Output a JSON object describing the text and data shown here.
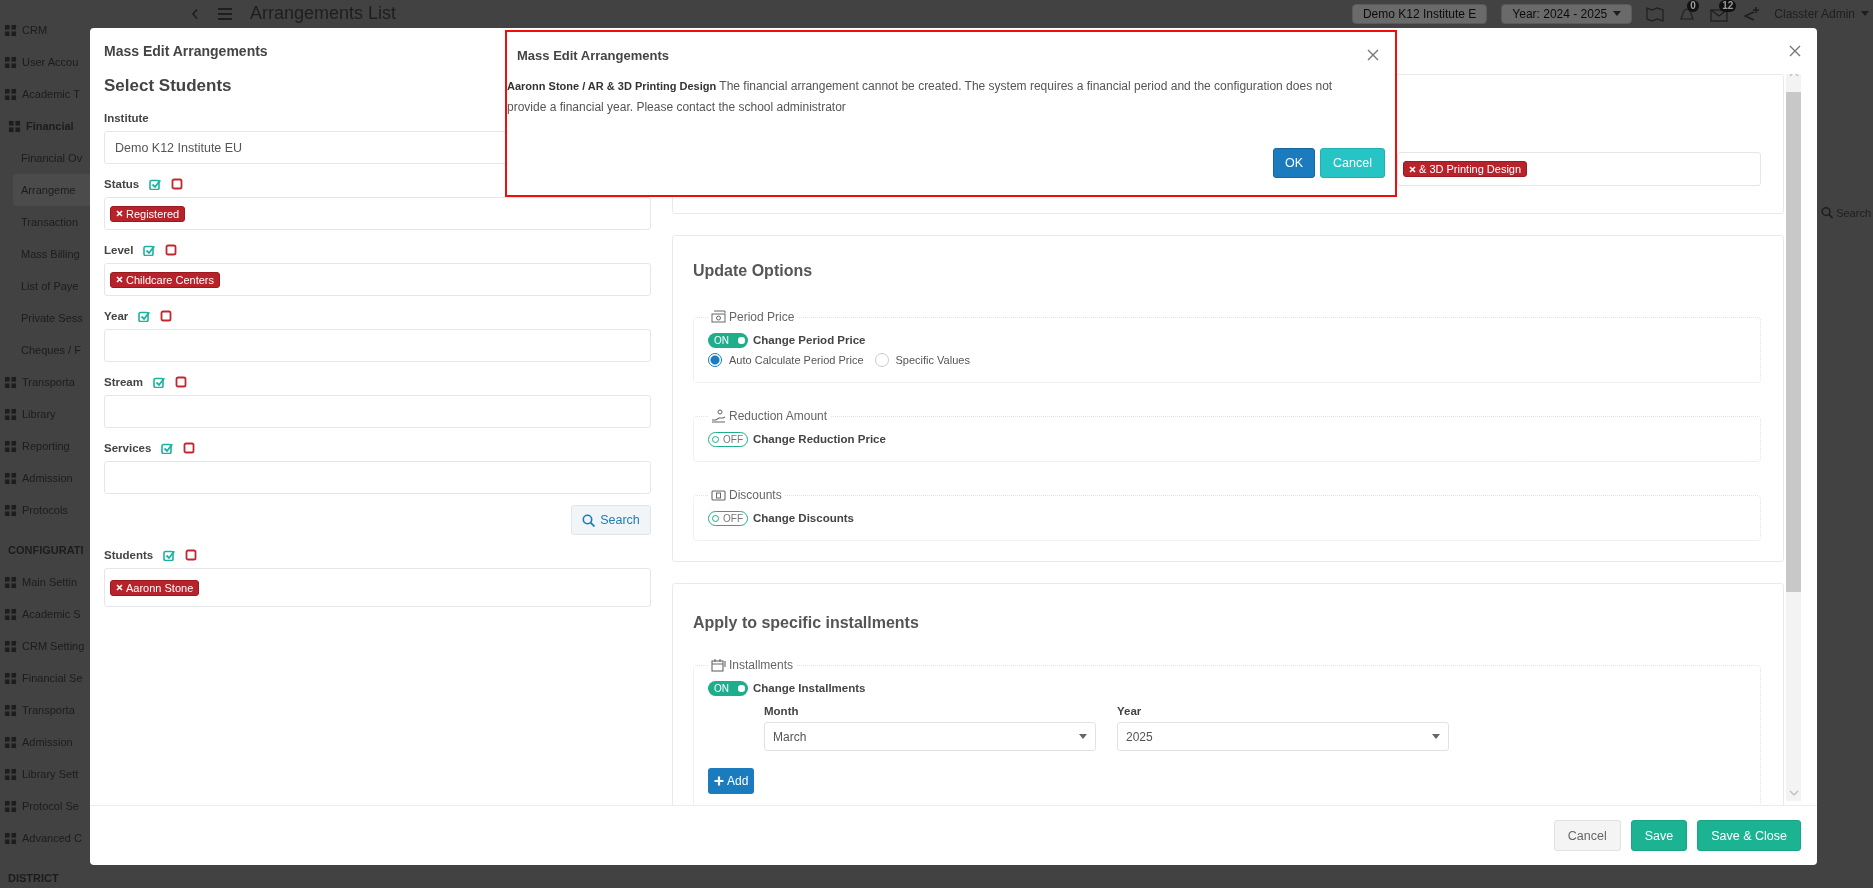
{
  "sidebar": {
    "items": [
      {
        "label": "CRM",
        "kind": "item",
        "selected": false
      },
      {
        "label": "User Accou",
        "kind": "item",
        "selected": false
      },
      {
        "label": "Academic T",
        "kind": "item",
        "selected": false
      },
      {
        "label": "Financial",
        "kind": "item",
        "selected": false,
        "expanded": true,
        "children": [
          {
            "label": "Financial Ov",
            "kind": "item",
            "selected": false
          },
          {
            "label": "Arrangeme",
            "kind": "item",
            "selected": true
          },
          {
            "label": "Transaction",
            "kind": "item",
            "selected": false
          },
          {
            "label": "Mass Billing",
            "kind": "item",
            "selected": false
          },
          {
            "label": "List of Paye",
            "kind": "item",
            "selected": false
          },
          {
            "label": "Private Sess",
            "kind": "item",
            "selected": false
          },
          {
            "label": "Cheques / F",
            "kind": "item",
            "selected": false
          }
        ]
      },
      {
        "label": "Transporta",
        "kind": "item",
        "selected": false
      },
      {
        "label": "Library",
        "kind": "item",
        "selected": false
      },
      {
        "label": "Reporting",
        "kind": "item",
        "selected": false
      },
      {
        "label": "Admission",
        "kind": "item",
        "selected": false
      },
      {
        "label": "Protocols",
        "kind": "item",
        "selected": false
      },
      {
        "label": "CONFIGURATI",
        "kind": "section"
      },
      {
        "label": "Main Settin",
        "kind": "item",
        "selected": false
      },
      {
        "label": "Academic S",
        "kind": "item",
        "selected": false
      },
      {
        "label": "CRM Setting",
        "kind": "item",
        "selected": false
      },
      {
        "label": "Financial Se",
        "kind": "item",
        "selected": false
      },
      {
        "label": "Transporta",
        "kind": "item",
        "selected": false
      },
      {
        "label": "Admission",
        "kind": "item",
        "selected": false
      },
      {
        "label": "Library Sett",
        "kind": "item",
        "selected": false
      },
      {
        "label": "Protocol Se",
        "kind": "item",
        "selected": false
      },
      {
        "label": "Advanced C",
        "kind": "item",
        "selected": false
      },
      {
        "label": "DISTRICT",
        "kind": "section"
      }
    ]
  },
  "header": {
    "page_title": "Arrangements List",
    "institute": "Demo K12 Institute E",
    "year": "Year: 2024 - 2025",
    "notifications": "0",
    "messages": "12",
    "user": "Classter Admin"
  },
  "background_search": "Search",
  "modal": {
    "title": "Mass Edit Arrangements",
    "select_students": {
      "heading": "Select Students",
      "filters": [
        {
          "label": "Institute",
          "kind": "select",
          "value": "Demo K12 Institute EU"
        },
        {
          "label": "Status",
          "kind": "tags",
          "tags": [
            "Registered"
          ]
        },
        {
          "label": "Level",
          "kind": "tags",
          "tags": [
            "Childcare Centers"
          ]
        },
        {
          "label": "Year",
          "kind": "tags"
        },
        {
          "label": "Stream",
          "kind": "tags"
        },
        {
          "label": "Services",
          "kind": "tags"
        }
      ],
      "search_button": "Search",
      "students": {
        "label": "Students",
        "tags": [
          "Aaronn Stone"
        ]
      }
    },
    "target_field": {
      "tags": [
        "& 3D Printing Design"
      ]
    },
    "update_options": {
      "title": "Update Options",
      "groups": [
        {
          "legend": "Period Price",
          "toggle": {
            "on": true,
            "state_text": "ON",
            "label": "Change Period Price"
          },
          "options": [
            {
              "label": "Auto Calculate Period Price",
              "selected": true
            },
            {
              "label": "Specific Values",
              "selected": false
            }
          ]
        },
        {
          "legend": "Reduction Amount",
          "toggle": {
            "on": false,
            "state_text": "OFF",
            "label": "Change Reduction Price"
          }
        },
        {
          "legend": "Discounts",
          "toggle": {
            "on": false,
            "state_text": "OFF",
            "label": "Change Discounts"
          }
        }
      ]
    },
    "installments": {
      "title": "Apply to specific installments",
      "legend": "Installments",
      "toggle": {
        "on": true,
        "state_text": "ON",
        "label": "Change Installments"
      },
      "month": {
        "label": "Month",
        "value": "March"
      },
      "year": {
        "label": "Year",
        "value": "2025"
      },
      "add_button": "Add"
    },
    "footer_buttons": [
      {
        "label": "Cancel",
        "kind": "default"
      },
      {
        "label": "Save",
        "kind": "primary"
      },
      {
        "label": "Save & Close",
        "kind": "primary"
      }
    ]
  },
  "dialog": {
    "title": "Mass Edit Arrangements",
    "message": "**Aaronn Stone / AR & 3D Printing Design** The financial arrangement cannot be created. The system requires a financial period and the configuration does not provide a financial year. Please contact the school administrator",
    "buttons": [
      {
        "label": "OK",
        "kind": "primary"
      },
      {
        "label": "Cancel",
        "kind": "secondary"
      }
    ]
  }
}
